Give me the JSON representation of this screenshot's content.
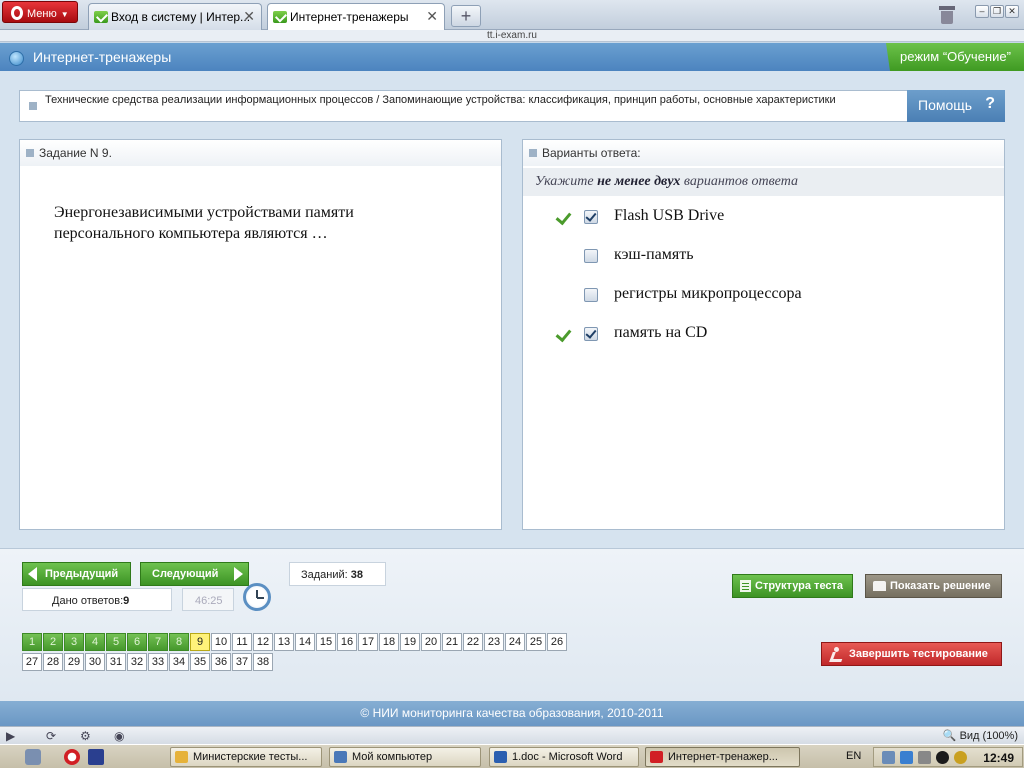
{
  "browser": {
    "menu_label": "Меню",
    "tabs": [
      {
        "title": "Вход в систему | Интер...",
        "close": "✕"
      },
      {
        "title": "Интернет-тренажеры",
        "close": "✕"
      }
    ],
    "new_tab": "+",
    "address": "tt.i-exam.ru",
    "window_buttons": [
      "–",
      "❐",
      "✕"
    ],
    "zoom_label": "Вид (100%)"
  },
  "app": {
    "title": "Интернет-тренажеры",
    "mode_label": "режим “Обучение”",
    "topic": "Технические средства реализации информационных процессов / Запоминающие устройства: классификация, принцип работы, основные характеристики",
    "help_label": "Помощь",
    "help_icon": "?"
  },
  "question": {
    "header": "Задание N 9.",
    "text": "Энергонезависимыми устройствами памяти персонального компьютера являются …"
  },
  "answers": {
    "header": "Варианты ответа:",
    "instruction_pre": "Укажите ",
    "instruction_bold": "не менее двух",
    "instruction_post": " вариантов ответа",
    "options": [
      {
        "label": "Flash USB Drive",
        "checked": true,
        "correct_mark": true
      },
      {
        "label": "кэш-память",
        "checked": false,
        "correct_mark": false
      },
      {
        "label": "регистры микропроцессора",
        "checked": false,
        "correct_mark": false
      },
      {
        "label": "память на CD",
        "checked": true,
        "correct_mark": true
      }
    ]
  },
  "controls": {
    "prev_label": "Предыдущий",
    "next_label": "Следующий",
    "tasks_label": "Заданий:",
    "tasks_count": "38",
    "answered_label": "Дано ответов:",
    "answered_count": "9",
    "timer": "46:25",
    "structure_label": "Структура теста",
    "show_solution_label": "Показать решение",
    "finish_label": "Завершить тестирование"
  },
  "question_grid": {
    "total": 38,
    "per_row": 26,
    "done": [
      1,
      2,
      3,
      4,
      5,
      6,
      7,
      8
    ],
    "current": 9
  },
  "footer": "© НИИ мониторинга качества образования, 2010-2011",
  "taskbar": {
    "tasks": [
      {
        "label": "Министерские тесты...",
        "color": "#e6b23a"
      },
      {
        "label": "Мой компьютер",
        "color": "#4a78b8"
      },
      {
        "label": "1.doc - Microsoft Word",
        "color": "#2b5fb0"
      },
      {
        "label": "Интернет-тренажер...",
        "color": "#d11f24"
      }
    ],
    "lang": "EN",
    "clock": "12:49"
  }
}
